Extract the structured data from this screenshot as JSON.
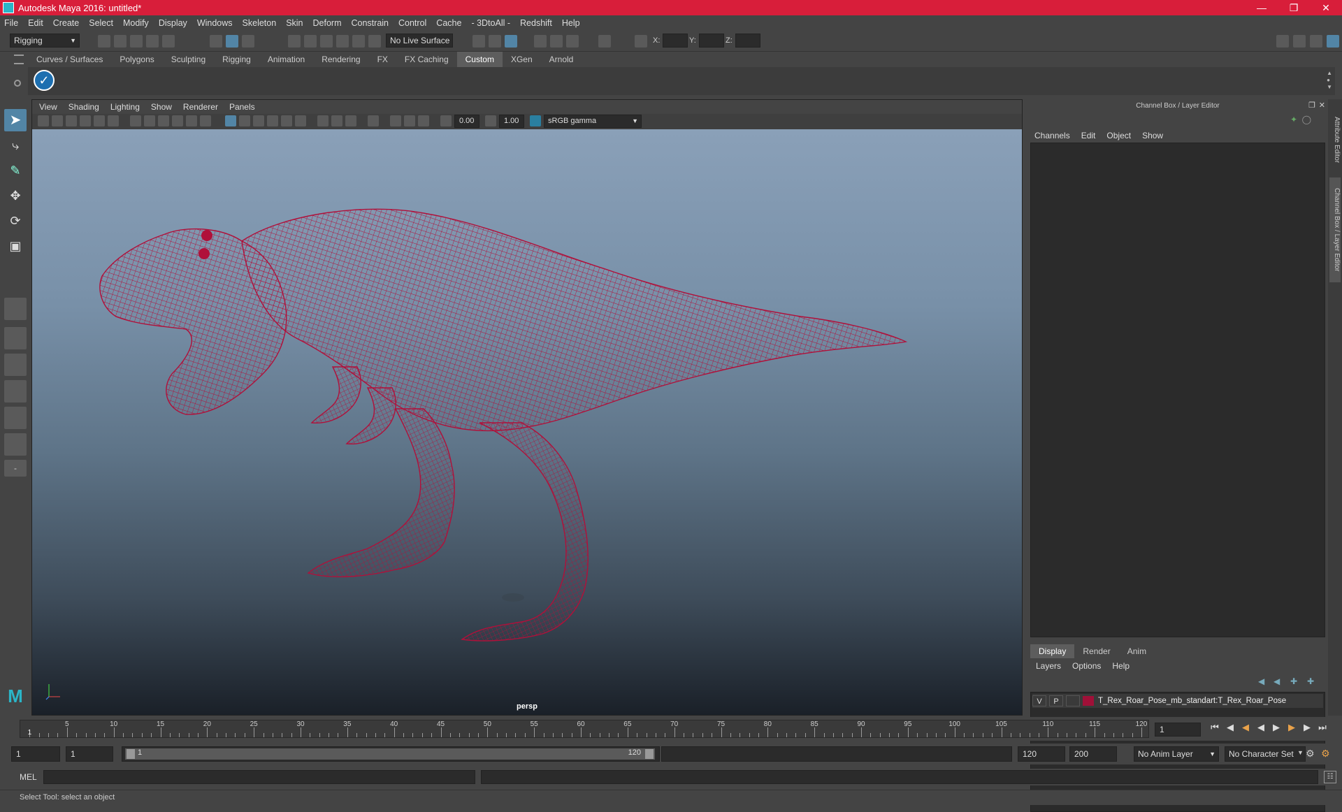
{
  "window": {
    "title": "Autodesk Maya 2016: untitled*"
  },
  "menus": [
    "File",
    "Edit",
    "Create",
    "Select",
    "Modify",
    "Display",
    "Windows",
    "Skeleton",
    "Skin",
    "Deform",
    "Constrain",
    "Control",
    "Cache",
    "- 3DtoAll -",
    "Redshift",
    "Help"
  ],
  "statusline": {
    "mode": "Rigging",
    "live_surface": "No Live Surface",
    "x_label": "X:",
    "y_label": "Y:",
    "z_label": "Z:"
  },
  "shelf_tabs": [
    "Curves / Surfaces",
    "Polygons",
    "Sculpting",
    "Rigging",
    "Animation",
    "Rendering",
    "FX",
    "FX Caching",
    "Custom",
    "XGen",
    "Arnold"
  ],
  "shelf_active": "Custom",
  "viewport": {
    "menus": [
      "View",
      "Shading",
      "Lighting",
      "Show",
      "Renderer",
      "Panels"
    ],
    "exposure": "0.00",
    "gamma": "1.00",
    "colorspace": "sRGB gamma",
    "camera_label": "persp",
    "wire_color": "#b0103a"
  },
  "channel_box": {
    "header": "Channel Box / Layer Editor",
    "menus": [
      "Channels",
      "Edit",
      "Object",
      "Show"
    ],
    "layer_tabs": [
      "Display",
      "Render",
      "Anim"
    ],
    "layer_active": "Display",
    "layer_menus": [
      "Layers",
      "Options",
      "Help"
    ],
    "layers": [
      {
        "v": "V",
        "p": "P",
        "name": "T_Rex_Roar_Pose_mb_standart:T_Rex_Roar_Pose",
        "color": "#a01038"
      }
    ]
  },
  "side_tabs": {
    "attribute": "Attribute Editor",
    "channel": "Channel Box / Layer Editor"
  },
  "timeline": {
    "ticks": [
      5,
      10,
      15,
      20,
      25,
      30,
      35,
      40,
      45,
      50,
      55,
      60,
      65,
      70,
      75,
      80,
      85,
      90,
      95,
      100,
      105,
      110,
      115,
      120
    ],
    "current_marker": "1",
    "current_frame": "1"
  },
  "range": {
    "start": "1",
    "playback_start": "1",
    "slider_start": "1",
    "slider_end": "120",
    "playback_end": "120",
    "end": "200",
    "anim_layer": "No Anim Layer",
    "char_set": "No Character Set"
  },
  "cmdline": {
    "lang": "MEL"
  },
  "help_text": "Select Tool: select an object"
}
